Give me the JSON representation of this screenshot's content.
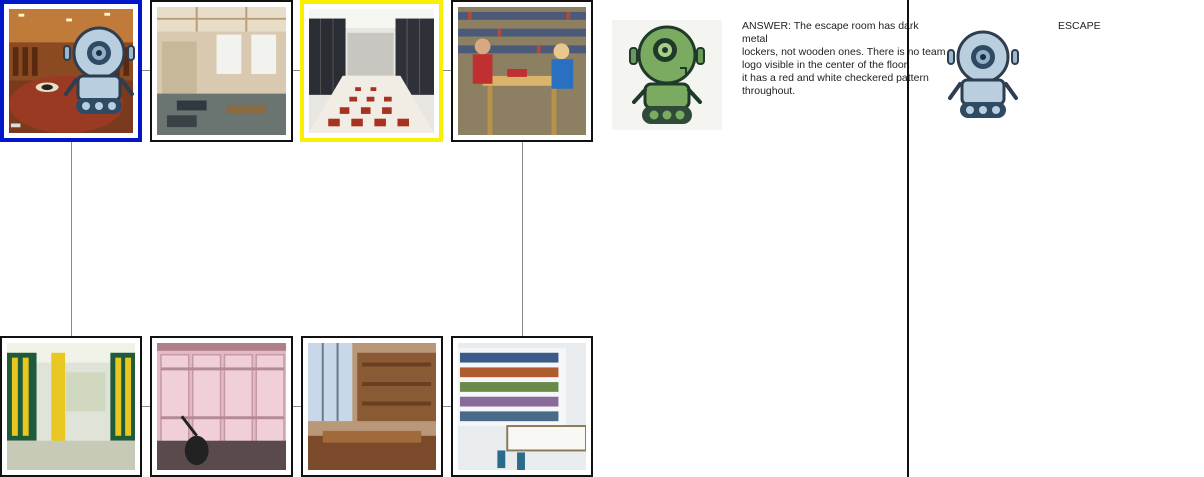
{
  "board": {
    "tiles_top": [
      {
        "name": "room-locker-room-wooden",
        "description": "locker-room-wooden",
        "selected": "agent"
      },
      {
        "name": "room-lounge-hall",
        "description": "lounge-hall",
        "selected": "none"
      },
      {
        "name": "room-metal-locker-checkered",
        "description": "metal-locker-checkered",
        "selected": "target"
      },
      {
        "name": "room-library-students",
        "description": "library-students",
        "selected": "none"
      }
    ],
    "tiles_bottom": [
      {
        "name": "room-yellow-locker-room",
        "description": "yellow-locker-room",
        "selected": "none"
      },
      {
        "name": "room-pink-lockers",
        "description": "pink-lockers",
        "selected": "none"
      },
      {
        "name": "room-reading-room",
        "description": "reading-room",
        "selected": "none"
      },
      {
        "name": "room-library-bookshelves",
        "description": "library-bookshelves",
        "selected": "none"
      }
    ],
    "selection_colors": {
      "agent": "#0016c8",
      "target": "#f8f000"
    }
  },
  "answer": {
    "text": "ANSWER: The escape room has dark metal\nlockers, not wooden ones. There is no team\nlogo visible in the center of the floor;\nit has a red and white checkered pattern\nthroughout."
  },
  "escape": {
    "label": "ESCAPE"
  },
  "icons": {
    "agent_robot": "robot-icon-blue",
    "guide_robot": "robot-icon-green"
  }
}
